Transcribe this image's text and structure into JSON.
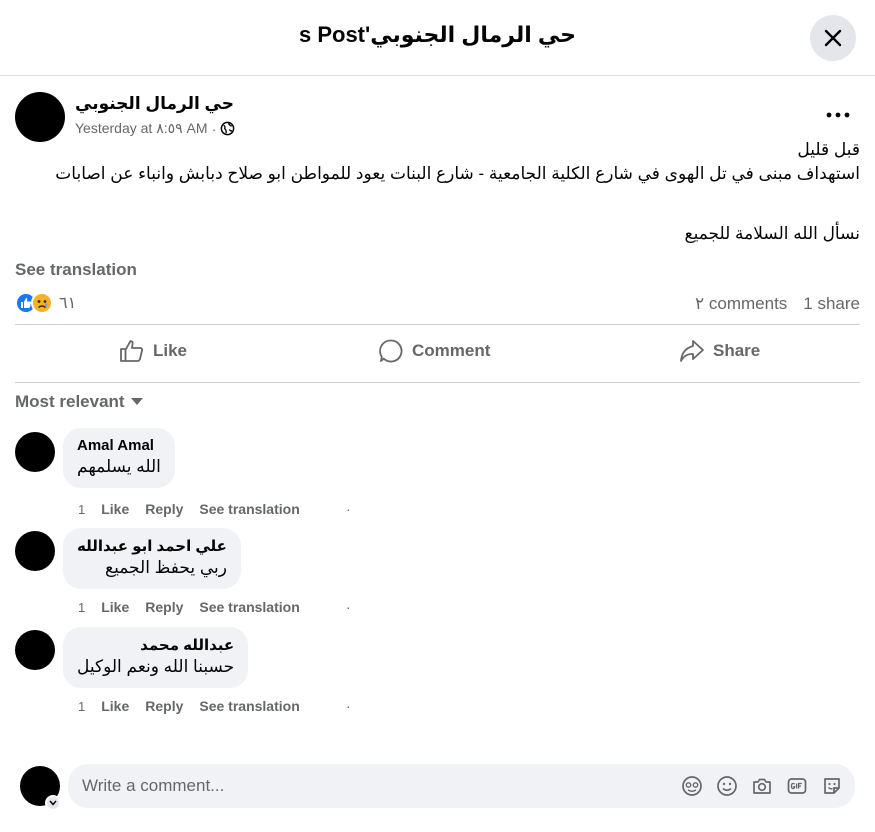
{
  "header": {
    "title": "حي الرمال الجنوبي's Post"
  },
  "post": {
    "author": "حي الرمال الجنوبي",
    "timestamp": "Yesterday at ٨:٥٩ AM",
    "meta_separator": "·",
    "line1": "قبل قليل",
    "line2": "استهداف مبنى في تل الهوى في شارع الكلية الجامعية - شارع البنات يعود للمواطن ابو صلاح دبابش وانباء عن اصابات",
    "line3": "نسأل الله السلامة للجميع",
    "see_translation": "See translation",
    "reaction_count": "٦١",
    "comments_count": "٢ comments",
    "shares_count": "1 share"
  },
  "actions": {
    "like": "Like",
    "comment": "Comment",
    "share": "Share"
  },
  "sort": {
    "label": "Most relevant"
  },
  "comments": [
    {
      "name": "Amal Amal",
      "text": "الله يسلمهم",
      "time": "1",
      "like": "Like",
      "reply": "Reply",
      "translate": "See translation"
    },
    {
      "name": "علي احمد ابو عبدالله",
      "text": "ربي يحفظ الجميع",
      "time": "1",
      "like": "Like",
      "reply": "Reply",
      "translate": "See translation"
    },
    {
      "name": "عبدالله محمد",
      "text": "حسبنا الله ونعم الوكيل",
      "time": "1",
      "like": "Like",
      "reply": "Reply",
      "translate": "See translation"
    }
  ],
  "composer": {
    "placeholder": "Write a comment..."
  },
  "colors": {
    "like_blue": "#1877f2",
    "sad_yellow": "#f7b125",
    "secondary_text": "#65676b"
  }
}
